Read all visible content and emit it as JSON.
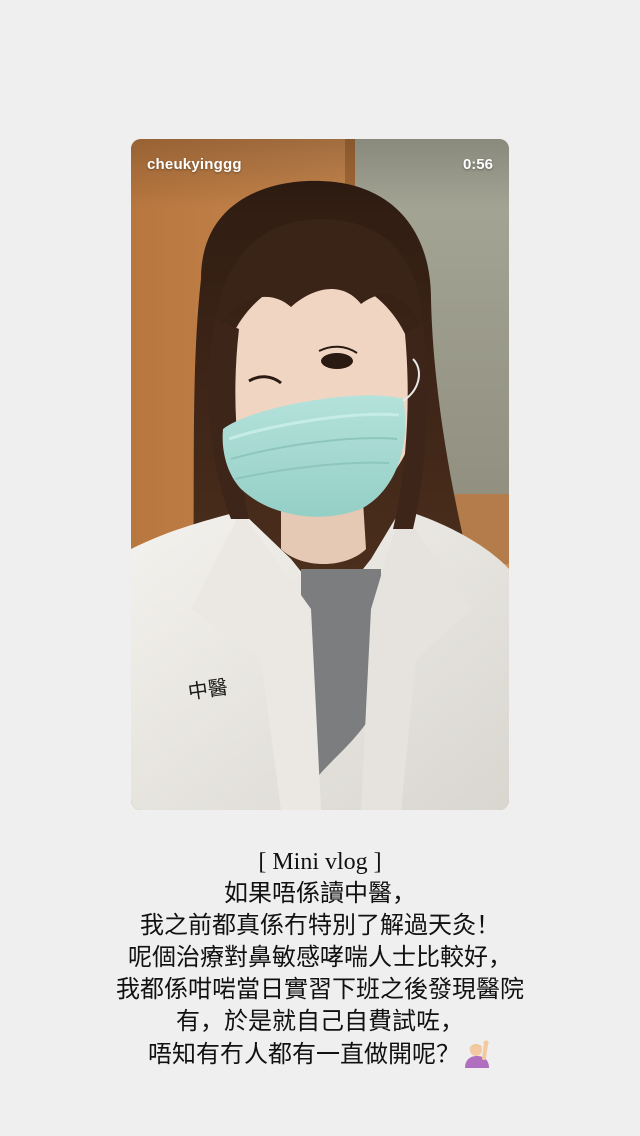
{
  "video": {
    "username": "cheukyinggg",
    "duration": "0:56"
  },
  "caption": {
    "lines": [
      "[ Mini vlog ]",
      "如果唔係讀中醫，",
      "我之前都真係冇特別了解過天灸！",
      "呢個治療對鼻敏感哮喘人士比較好，",
      "我都係咁啱當日實習下班之後發現醫院",
      "有，於是就自己自費試咗，",
      "唔知有冇人都有一直做開呢？"
    ],
    "trailing_icon": "person-raising-hand-icon"
  },
  "coat_embroidery": "中醫",
  "colors": {
    "page_background": "#efefef",
    "caption_text": "#111111",
    "overlay_text": "#ffffff",
    "mask": "#a8dbd4",
    "hair": "#3a2418",
    "door_wood": "#c07d45",
    "wall": "#a9a99c"
  }
}
